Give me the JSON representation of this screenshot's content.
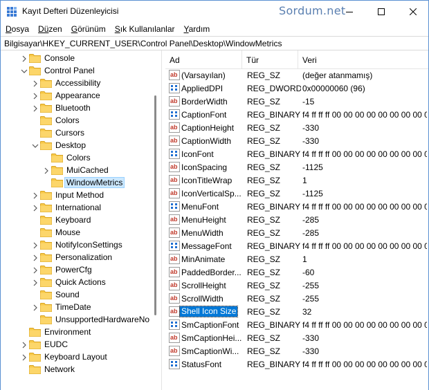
{
  "window": {
    "title": "Kayıt Defteri Düzenleyicisi",
    "watermark": "Sordum.net",
    "accent": "#0078d7"
  },
  "menu": [
    {
      "label": "Dosya",
      "accel": "D",
      "rest": "osya"
    },
    {
      "label": "Düzen",
      "accel": "Dü",
      "rest": "zen"
    },
    {
      "label": "Görünüm",
      "accel": "G",
      "rest": "örünüm"
    },
    {
      "label": "Sık Kullanılanlar",
      "accel": "S",
      "rest": "ık Kullanılanlar"
    },
    {
      "label": "Yardım",
      "accel": "Y",
      "rest": "ardım"
    }
  ],
  "address": "Bilgisayar\\HKEY_CURRENT_USER\\Control Panel\\Desktop\\WindowMetrics",
  "tree": [
    {
      "label": "Console",
      "level": 1,
      "twisty": "collapsed"
    },
    {
      "label": "Control Panel",
      "level": 1,
      "twisty": "expanded"
    },
    {
      "label": "Accessibility",
      "level": 2,
      "twisty": "collapsed"
    },
    {
      "label": "Appearance",
      "level": 2,
      "twisty": "collapsed"
    },
    {
      "label": "Bluetooth",
      "level": 2,
      "twisty": "collapsed"
    },
    {
      "label": "Colors",
      "level": 2,
      "twisty": "none"
    },
    {
      "label": "Cursors",
      "level": 2,
      "twisty": "none"
    },
    {
      "label": "Desktop",
      "level": 2,
      "twisty": "expanded"
    },
    {
      "label": "Colors",
      "level": 3,
      "twisty": "none"
    },
    {
      "label": "MuiCached",
      "level": 3,
      "twisty": "collapsed"
    },
    {
      "label": "WindowMetrics",
      "level": 3,
      "twisty": "none",
      "selected": true
    },
    {
      "label": "Input Method",
      "level": 2,
      "twisty": "collapsed"
    },
    {
      "label": "International",
      "level": 2,
      "twisty": "collapsed"
    },
    {
      "label": "Keyboard",
      "level": 2,
      "twisty": "none"
    },
    {
      "label": "Mouse",
      "level": 2,
      "twisty": "none"
    },
    {
      "label": "NotifyIconSettings",
      "level": 2,
      "twisty": "collapsed"
    },
    {
      "label": "Personalization",
      "level": 2,
      "twisty": "collapsed"
    },
    {
      "label": "PowerCfg",
      "level": 2,
      "twisty": "collapsed"
    },
    {
      "label": "Quick Actions",
      "level": 2,
      "twisty": "collapsed"
    },
    {
      "label": "Sound",
      "level": 2,
      "twisty": "none"
    },
    {
      "label": "TimeDate",
      "level": 2,
      "twisty": "collapsed"
    },
    {
      "label": "UnsupportedHardwareNo",
      "level": 2,
      "twisty": "none"
    },
    {
      "label": "Environment",
      "level": 1,
      "twisty": "none"
    },
    {
      "label": "EUDC",
      "level": 1,
      "twisty": "collapsed"
    },
    {
      "label": "Keyboard Layout",
      "level": 1,
      "twisty": "collapsed"
    },
    {
      "label": "Network",
      "level": 1,
      "twisty": "none"
    }
  ],
  "columns": {
    "name": "Ad",
    "type": "Tür",
    "data": "Veri"
  },
  "values": [
    {
      "name": "(Varsayılan)",
      "type": "REG_SZ",
      "data": "(değer atanmamış)",
      "icon": "string"
    },
    {
      "name": "AppliedDPI",
      "type": "REG_DWORD",
      "data": "0x00000060 (96)",
      "icon": "binary"
    },
    {
      "name": "BorderWidth",
      "type": "REG_SZ",
      "data": "-15",
      "icon": "string"
    },
    {
      "name": "CaptionFont",
      "type": "REG_BINARY",
      "data": "f4 ff ff ff 00 00 00 00 00 00 00 00 00 00",
      "icon": "binary"
    },
    {
      "name": "CaptionHeight",
      "type": "REG_SZ",
      "data": "-330",
      "icon": "string"
    },
    {
      "name": "CaptionWidth",
      "type": "REG_SZ",
      "data": "-330",
      "icon": "string"
    },
    {
      "name": "IconFont",
      "type": "REG_BINARY",
      "data": "f4 ff ff ff 00 00 00 00 00 00 00 00 00 00",
      "icon": "binary"
    },
    {
      "name": "IconSpacing",
      "type": "REG_SZ",
      "data": "-1125",
      "icon": "string"
    },
    {
      "name": "IconTitleWrap",
      "type": "REG_SZ",
      "data": "1",
      "icon": "string"
    },
    {
      "name": "IconVerticalSp...",
      "type": "REG_SZ",
      "data": "-1125",
      "icon": "string"
    },
    {
      "name": "MenuFont",
      "type": "REG_BINARY",
      "data": "f4 ff ff ff 00 00 00 00 00 00 00 00 00 00",
      "icon": "binary"
    },
    {
      "name": "MenuHeight",
      "type": "REG_SZ",
      "data": "-285",
      "icon": "string"
    },
    {
      "name": "MenuWidth",
      "type": "REG_SZ",
      "data": "-285",
      "icon": "string"
    },
    {
      "name": "MessageFont",
      "type": "REG_BINARY",
      "data": "f4 ff ff ff 00 00 00 00 00 00 00 00 00 00",
      "icon": "binary"
    },
    {
      "name": "MinAnimate",
      "type": "REG_SZ",
      "data": "1",
      "icon": "string"
    },
    {
      "name": "PaddedBorder...",
      "type": "REG_SZ",
      "data": "-60",
      "icon": "string"
    },
    {
      "name": "ScrollHeight",
      "type": "REG_SZ",
      "data": "-255",
      "icon": "string"
    },
    {
      "name": "ScrollWidth",
      "type": "REG_SZ",
      "data": "-255",
      "icon": "string"
    },
    {
      "name": "Shell Icon Size",
      "type": "REG_SZ",
      "data": "32",
      "icon": "string",
      "selected": true
    },
    {
      "name": "SmCaptionFont",
      "type": "REG_BINARY",
      "data": "f4 ff ff ff 00 00 00 00 00 00 00 00 00 00",
      "icon": "binary"
    },
    {
      "name": "SmCaptionHei...",
      "type": "REG_SZ",
      "data": "-330",
      "icon": "string"
    },
    {
      "name": "SmCaptionWi...",
      "type": "REG_SZ",
      "data": "-330",
      "icon": "string"
    },
    {
      "name": "StatusFont",
      "type": "REG_BINARY",
      "data": "f4 ff ff ff 00 00 00 00 00 00 00 00 00 00",
      "icon": "binary"
    }
  ]
}
